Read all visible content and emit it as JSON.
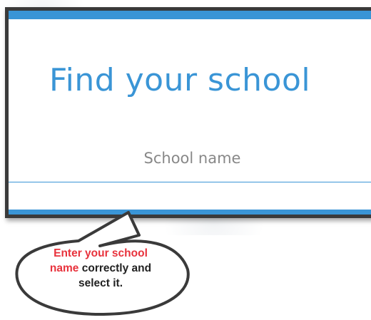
{
  "page": {
    "title": "Find your school"
  },
  "school_field": {
    "placeholder": "School name"
  },
  "callout": {
    "line1_red": "Enter your school",
    "line2_red": "name",
    "line2_rest": " correctly and",
    "line3": "select it."
  },
  "colors": {
    "accent": "#3a95d6",
    "frame": "#3a3a3a",
    "callout_highlight": "#e8323c"
  }
}
